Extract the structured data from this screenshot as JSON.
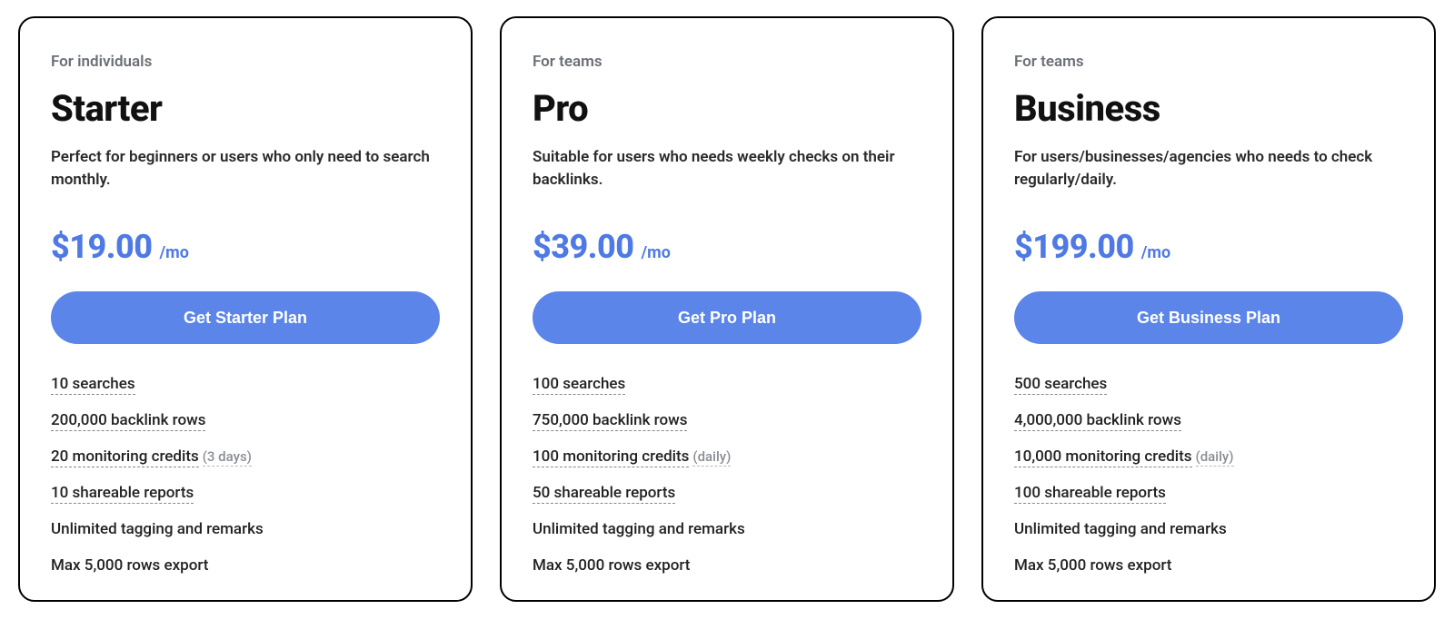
{
  "plans": [
    {
      "audience": "For individuals",
      "name": "Starter",
      "description": "Perfect for beginners or users who only need to search monthly.",
      "price": "$19.00",
      "period": "/mo",
      "cta": "Get Starter Plan",
      "features": [
        {
          "text": "10 searches",
          "underlined": true
        },
        {
          "text": "200,000 backlink rows",
          "underlined": true
        },
        {
          "text": "20 monitoring credits",
          "hint": "(3 days)",
          "underlined": true
        },
        {
          "text": "10 shareable reports",
          "underlined": true
        },
        {
          "text": "Unlimited tagging and remarks",
          "underlined": false
        },
        {
          "text": "Max 5,000 rows export",
          "underlined": false
        }
      ]
    },
    {
      "audience": "For teams",
      "name": "Pro",
      "description": "Suitable for users who needs weekly checks on their backlinks.",
      "price": "$39.00",
      "period": "/mo",
      "cta": "Get Pro Plan",
      "features": [
        {
          "text": "100 searches",
          "underlined": true
        },
        {
          "text": "750,000 backlink rows",
          "underlined": true
        },
        {
          "text": "100 monitoring credits",
          "hint": "(daily)",
          "underlined": true
        },
        {
          "text": "50 shareable reports",
          "underlined": true
        },
        {
          "text": "Unlimited tagging and remarks",
          "underlined": false
        },
        {
          "text": "Max 5,000 rows export",
          "underlined": false
        }
      ]
    },
    {
      "audience": "For teams",
      "name": "Business",
      "description": "For users/businesses/agencies who needs to check regularly/daily.",
      "price": "$199.00",
      "period": "/mo",
      "cta": "Get Business Plan",
      "features": [
        {
          "text": "500 searches",
          "underlined": true
        },
        {
          "text": "4,000,000 backlink rows",
          "underlined": true
        },
        {
          "text": "10,000 monitoring credits",
          "hint": "(daily)",
          "underlined": true
        },
        {
          "text": "100 shareable reports",
          "underlined": true
        },
        {
          "text": "Unlimited tagging and remarks",
          "underlined": false
        },
        {
          "text": "Max 5,000 rows export",
          "underlined": false
        }
      ]
    }
  ]
}
